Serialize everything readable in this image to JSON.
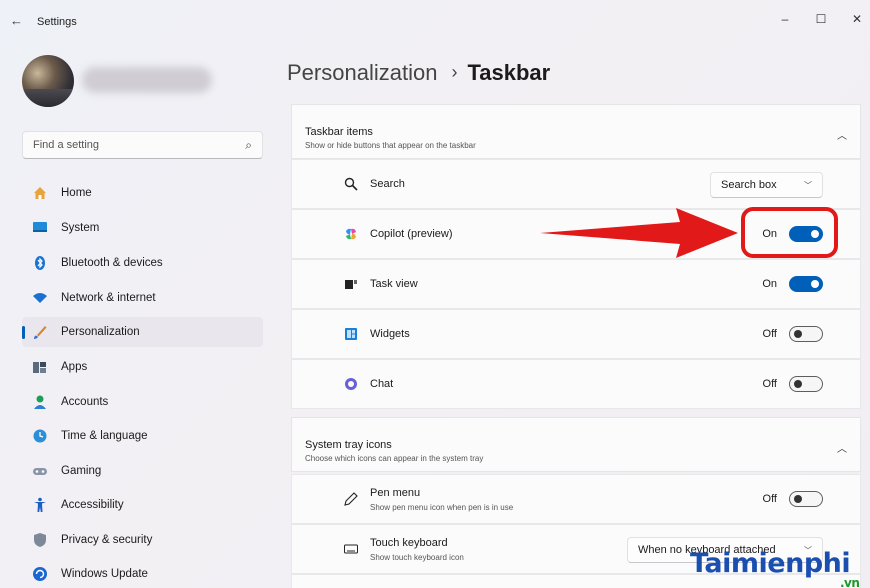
{
  "window": {
    "title": "Settings",
    "back_icon": "arrow-left-icon",
    "controls": {
      "minimize": "–",
      "maximize": "☐",
      "close": "✕"
    }
  },
  "profile": {
    "avatar": "avatar-photo",
    "name_obscured": true
  },
  "search": {
    "placeholder": "Find a setting",
    "icon": "search-icon"
  },
  "sidebar": {
    "items": [
      {
        "label": "Home",
        "icon": "home-icon",
        "active": false
      },
      {
        "label": "System",
        "icon": "monitor-icon",
        "active": false
      },
      {
        "label": "Bluetooth & devices",
        "icon": "bluetooth-icon",
        "active": false
      },
      {
        "label": "Network & internet",
        "icon": "wifi-icon",
        "active": false
      },
      {
        "label": "Personalization",
        "icon": "paintbrush-icon",
        "active": true
      },
      {
        "label": "Apps",
        "icon": "apps-icon",
        "active": false
      },
      {
        "label": "Accounts",
        "icon": "person-icon",
        "active": false
      },
      {
        "label": "Time & language",
        "icon": "globe-clock-icon",
        "active": false
      },
      {
        "label": "Gaming",
        "icon": "gamepad-icon",
        "active": false
      },
      {
        "label": "Accessibility",
        "icon": "accessibility-icon",
        "active": false
      },
      {
        "label": "Privacy & security",
        "icon": "shield-icon",
        "active": false
      },
      {
        "label": "Windows Update",
        "icon": "update-icon",
        "active": false
      }
    ]
  },
  "breadcrumb": {
    "parent": "Personalization",
    "separator": "›",
    "current": "Taskbar"
  },
  "taskbar_items": {
    "title": "Taskbar items",
    "subtitle": "Show or hide buttons that appear on the taskbar",
    "rows": [
      {
        "label": "Search",
        "icon": "search-icon",
        "control": "dropdown",
        "value": "Search box"
      },
      {
        "label": "Copilot (preview)",
        "icon": "copilot-icon",
        "control": "toggle",
        "state": "On",
        "on": true
      },
      {
        "label": "Task view",
        "icon": "task-view-icon",
        "control": "toggle",
        "state": "On",
        "on": true
      },
      {
        "label": "Widgets",
        "icon": "widgets-icon",
        "control": "toggle",
        "state": "Off",
        "on": false
      },
      {
        "label": "Chat",
        "icon": "chat-icon",
        "control": "toggle",
        "state": "Off",
        "on": false
      }
    ]
  },
  "system_tray": {
    "title": "System tray icons",
    "subtitle": "Choose which icons can appear in the system tray",
    "rows": [
      {
        "label": "Pen menu",
        "sub": "Show pen menu icon when pen is in use",
        "icon": "pen-icon",
        "control": "toggle",
        "state": "Off",
        "on": false
      },
      {
        "label": "Touch keyboard",
        "sub": "Show touch keyboard icon",
        "icon": "keyboard-icon",
        "control": "dropdown",
        "value": "When no keyboard attached"
      }
    ]
  },
  "annotation": {
    "color": "#e11919",
    "target": "Copilot (preview) toggle"
  },
  "watermark": {
    "text": "Taimienphi",
    "suffix": ".vn"
  },
  "colors": {
    "accent": "#005fb8",
    "annotation": "#e11919"
  }
}
